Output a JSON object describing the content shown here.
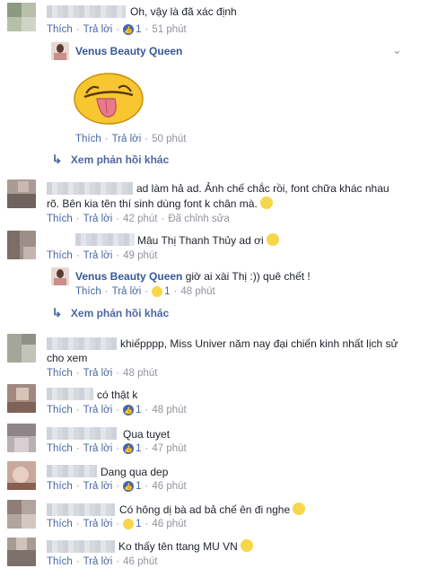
{
  "actions": {
    "like": "Thích",
    "reply": "Trả lời",
    "sep": "·"
  },
  "page_name": "Venus Beauty Queen",
  "see_more_replies": "Xem phản hồi khác",
  "colors": {
    "link": "#365899",
    "meta": "#90949c",
    "like_blue": "#4267b2"
  },
  "comments": [
    {
      "text": "Oh, vậy là đã xác định",
      "likes": "1",
      "time": "51 phút",
      "reaction": "like"
    },
    {
      "text": "",
      "time": "50 phút",
      "attachment": "tongue-out sticker"
    },
    {
      "text": "ad làm hả ad. Ảnh chế chắc rồi, font chữa khác nhau",
      "text2": "rõ. Bên kia tên thí sinh dùng font k chân mà.",
      "time": "42 phút",
      "edited": "Đã chỉnh sửa",
      "emoji": "smirk"
    },
    {
      "text": "Mâu Thị Thanh Thủy ad ơi",
      "time": "49 phút",
      "emoji": "laugh"
    },
    {
      "text": "giờ ai xài Thị :)) quê chết !",
      "likes": "1",
      "time": "48 phút",
      "reaction": "haha"
    },
    {
      "text": "khiếpppp, Miss Univer năm nay đại chiến kinh nhất lịch sử",
      "text2": "cho xem",
      "time": "48 phút"
    },
    {
      "text": "có thật k",
      "likes": "1",
      "time": "48 phút",
      "reaction": "like"
    },
    {
      "text": "Qua tuyet",
      "likes": "1",
      "time": "47 phút",
      "reaction": "like"
    },
    {
      "text": "Dang qua dep",
      "likes": "1",
      "time": "46 phút",
      "reaction": "like"
    },
    {
      "text": "Có hông dị bà ad bả chế ên đi nghe",
      "likes": "1",
      "time": "46 phút",
      "reaction": "haha",
      "emoji": "unamused"
    },
    {
      "text": "Ko thấy tên ttang MU VN",
      "time": "46 phút",
      "emoji": "expressionless"
    }
  ]
}
